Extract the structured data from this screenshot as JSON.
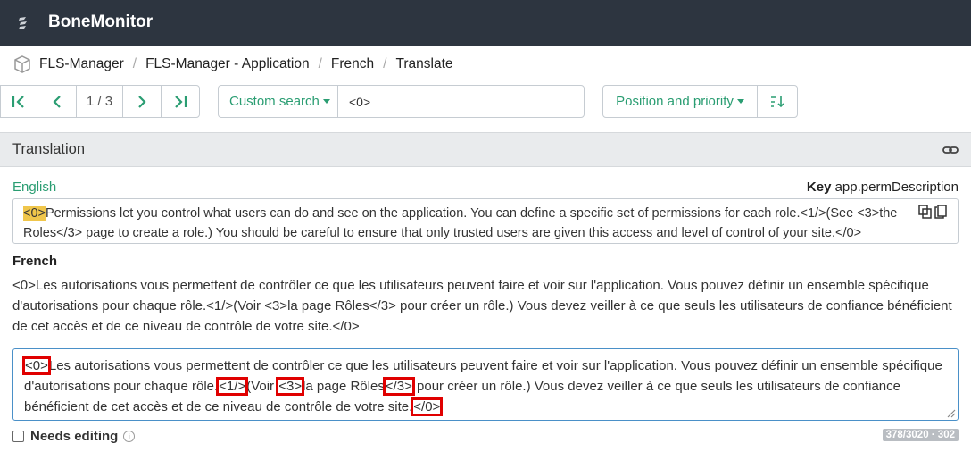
{
  "app": {
    "title": "BoneMonitor"
  },
  "breadcrumb": [
    "FLS-Manager",
    "FLS-Manager - Application",
    "French",
    "Translate"
  ],
  "navigation": {
    "counter": "1 / 3"
  },
  "search": {
    "mode_label": "Custom search",
    "value": "<0>"
  },
  "sort": {
    "label": "Position and priority"
  },
  "panel": {
    "title": "Translation"
  },
  "source": {
    "language": "English",
    "key_label": "Key",
    "key_value": "app.permDescription",
    "first_tag": "<0>",
    "text_rest": "Permissions let you control what users can do and see on the application. You can define a specific set of permissions for each role.<1/>(See <3>the Roles</3> page to create a role.) You should be careful to ensure that only trusted users are given this access and level of control of your site.</0>"
  },
  "french": {
    "label": "French",
    "text": "<0>Les autorisations vous permettent de contrôler ce que les utilisateurs peuvent faire et voir sur l'application. Vous pouvez définir un ensemble spécifique d'autorisations pour chaque rôle.<1/>(Voir <3>la page Rôles</3> pour créer un rôle.) Vous devez veiller à ce que seuls les utilisateurs de confiance bénéficient de cet accès et de ce niveau de contrôle de votre site.</0>"
  },
  "editor": {
    "tag0": "<0>",
    "part1": "Les autorisations vous permettent de contrôler ce que les utilisateurs peuvent faire et voir sur l'application. Vous pouvez définir un ensemble spécifique d'autorisations pour chaque rôle.",
    "tag1": "<1/>",
    "part2": "(Voir ",
    "tag3": "<3>",
    "part3": "la page Rôles",
    "tag3close": "</3>",
    "part4": " pour créer un rôle.) Vous devez veiller à ce que seuls les utilisateurs de confiance bénéficient de cet accès et de ce niveau de contrôle de votre site.",
    "tag0close": "</0>"
  },
  "needs_editing": {
    "label": "Needs editing",
    "checked": false
  },
  "stats": {
    "text": "378/3020 · 302"
  },
  "colors": {
    "topbar": "#2d3540",
    "accent": "#2a9d72",
    "highlight": "#f0c64b",
    "tag_outline": "#e00000"
  }
}
